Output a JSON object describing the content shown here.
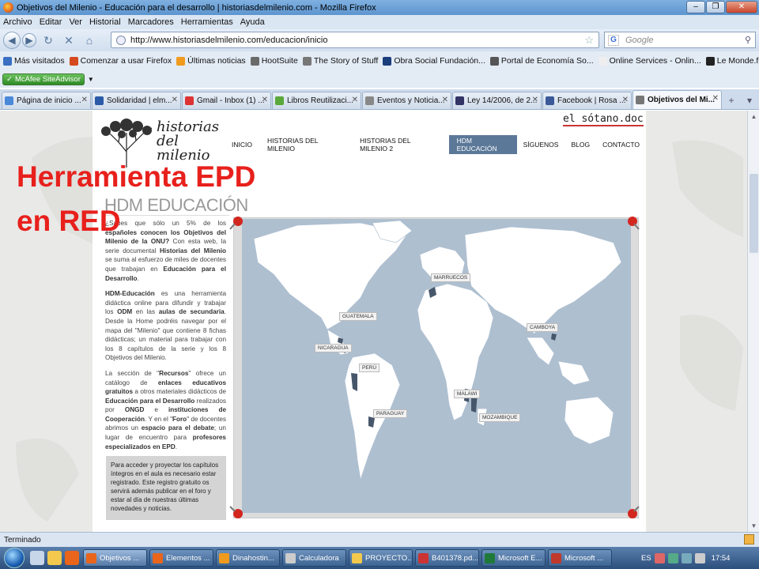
{
  "window": {
    "title": "Objetivos del Milenio - Educación para el desarrollo | historiasdelmilenio.com - Mozilla Firefox"
  },
  "menu": [
    "Archivo",
    "Editar",
    "Ver",
    "Historial",
    "Marcadores",
    "Herramientas",
    "Ayuda"
  ],
  "nav": {
    "url": "http://www.historiasdelmilenio.com/educacion/inicio",
    "search_placeholder": "Google"
  },
  "bookmarks": [
    {
      "label": "Más visitados",
      "color": "#3a6fc2"
    },
    {
      "label": "Comenzar a usar Firefox",
      "color": "#d44a1e"
    },
    {
      "label": "Últimas noticias",
      "color": "#f09a1e"
    },
    {
      "label": "HootSuite",
      "color": "#6a6a6a"
    },
    {
      "label": "The Story of Stuff",
      "color": "#777"
    },
    {
      "label": "Obra Social Fundación...",
      "color": "#1a3d7c"
    },
    {
      "label": "Portal de Economía So...",
      "color": "#555"
    },
    {
      "label": "Online Services - Onlin...",
      "color": "#eee"
    },
    {
      "label": "Le Monde.fr : Webdoc...",
      "color": "#222"
    }
  ],
  "mcafee": {
    "label": "McAfee SiteAdvisor"
  },
  "tabs": [
    {
      "label": "Página de inicio ...",
      "color": "#4a88d9"
    },
    {
      "label": "Solidaridad | elm...",
      "color": "#2a5aa8"
    },
    {
      "label": "Gmail - Inbox (1) ...",
      "color": "#d33"
    },
    {
      "label": "Libros Reutilizaci...",
      "color": "#5aa83a"
    },
    {
      "label": "Eventos y Noticia...",
      "color": "#888"
    },
    {
      "label": "Ley 14/2006, de 2...",
      "color": "#336"
    },
    {
      "label": "Facebook | Rosa ...",
      "color": "#3b5998"
    },
    {
      "label": "Objetivos del Mi...",
      "color": "#777",
      "active": true
    }
  ],
  "site": {
    "brand": "historias del milenio",
    "sotano": "el sótano.doc",
    "menu": [
      "INICIO",
      "HISTORIAS DEL MILENIO",
      "HISTORIAS DEL MILENIO 2",
      "HDM EDUCACIÓN",
      "SÍGUENOS",
      "BLOG",
      "CONTACTO"
    ],
    "active_menu": "HDM EDUCACIÓN",
    "overlay_line1": "Herramienta EPD",
    "overlay_line2": "en RED",
    "heading": "HDM EDUCACIÓN",
    "p1_a": "¿Sabes que sólo un 5% de los ",
    "p1_b": "españoles conocen los Objetivos del Milenio de la ONU?",
    "p1_c": " Con esta web, la serie documental ",
    "p1_d": "Historias del Milenio",
    "p1_e": " se suma al esfuerzo de miles de docentes que trabajan en ",
    "p1_f": "Educación para el Desarrollo",
    "p2_a": "HDM-Educación",
    "p2_b": " es una herramienta didáctica online para difundir y trabajar los ",
    "p2_c": "ODM",
    "p2_d": " en las ",
    "p2_e": "aulas de secundaria",
    "p2_f": ". Desde la Home podréis navegar por el mapa del \"Milenio\" que contiene 8 fichas didácticas; un material para trabajar con los 8 capítulos de la serie y los 8 Objetivos del Milenio.",
    "p3_a": "La sección de \"",
    "p3_b": "Recursos",
    "p3_c": "\" ofrece un catálogo de ",
    "p3_d": "enlaces educativos gratuitos",
    "p3_e": " a otros materiales didácticos de ",
    "p3_f": "Educación para el Desarrollo",
    "p3_g": " realizados por ",
    "p3_h": "ONGD",
    "p3_i": " e ",
    "p3_j": "instituciones de Cooperación",
    "p3_k": ". Y en el \"",
    "p3_l": "Foro",
    "p3_m": "\" de docentes abrimos un ",
    "p3_n": "espacio para el debate",
    "p3_o": "; un lugar de encuentro para ",
    "p3_p": "profesores especializados en EPD",
    "note": "Para acceder y proyectar los capítulos íntegros en el aula es necesario estar registrado. Este registro gratuito os servirá además publicar en el foro y estar al día de nuestras últimas novedades y noticias.",
    "map_labels": {
      "marruecos": "MARRUECOS",
      "guatemala": "GUATEMALA",
      "nicaragua": "NICARAGUA",
      "camboya": "CAMBOYA",
      "peru": "PERÚ",
      "malawi": "MALAWI",
      "paraguay": "PARAGUAY",
      "mozambique": "MOZAMBIQUE"
    }
  },
  "status": "Terminado",
  "taskbar": {
    "items": [
      {
        "label": "Objetivos ...",
        "color": "#e8651b",
        "active": true
      },
      {
        "label": "Elementos ...",
        "color": "#e8651b"
      },
      {
        "label": "Dinahostin...",
        "color": "#f09a1e"
      },
      {
        "label": "Calculadora",
        "color": "#ccc"
      },
      {
        "label": "PROYECTO...",
        "color": "#f2c94c"
      },
      {
        "label": "B401378.pd...",
        "color": "#c33"
      },
      {
        "label": "Microsoft E...",
        "color": "#1f7a3a"
      },
      {
        "label": "Microsoft ...",
        "color": "#c0392b"
      }
    ],
    "lang": "ES",
    "time": "17:54"
  }
}
